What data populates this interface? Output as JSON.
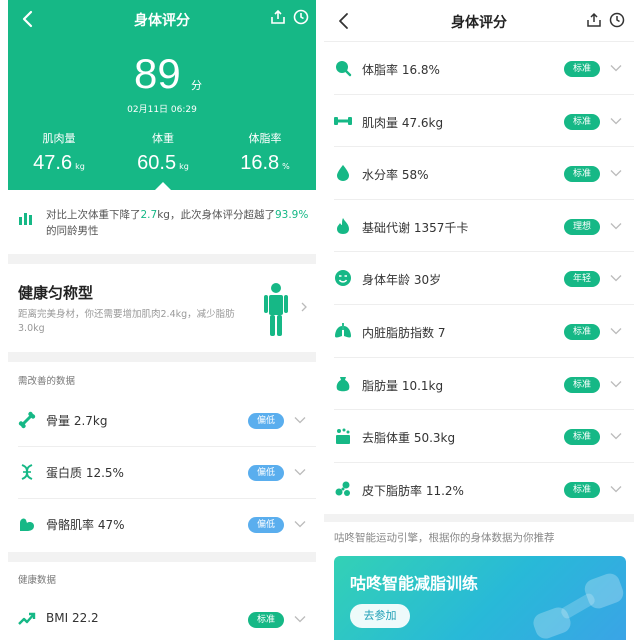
{
  "colors": {
    "accent": "#16b886",
    "low_badge": "#5aaeee",
    "page_sep": "#f2f2f2"
  },
  "left": {
    "header": {
      "title": "身体评分",
      "back_icon": "chevron-left-icon",
      "share_icon": "share-icon",
      "history_icon": "clock-icon"
    },
    "score": {
      "value": "89",
      "unit": "分",
      "date": "02月11日 06:29"
    },
    "metrics": [
      {
        "label": "肌肉量",
        "value": "47.6",
        "unit": "kg"
      },
      {
        "label": "体重",
        "value": "60.5",
        "unit": "kg"
      },
      {
        "label": "体脂率",
        "value": "16.8",
        "unit": "%"
      }
    ],
    "compare": {
      "icon": "bar-chart-icon",
      "text_1": "对比上次体重下降了",
      "weight_change": "2.7",
      "text_2": "kg，此次身体评分超越了",
      "percent": "93.9%",
      "text_3": "的同龄男性"
    },
    "body_type": {
      "title": "健康匀称型",
      "description": "距离完美身材，你还需要增加肌肉2.4kg，减少脂肪3.0kg",
      "figure_icon": "person-icon"
    },
    "improve_section": {
      "heading": "需改善的数据",
      "items": [
        {
          "icon": "bone-icon",
          "label": "骨量 2.7kg",
          "badge": "偏低"
        },
        {
          "icon": "dna-icon",
          "label": "蛋白质 12.5%",
          "badge": "偏低"
        },
        {
          "icon": "muscle-arm-icon",
          "label": "骨骼肌率 47%",
          "badge": "偏低"
        }
      ]
    },
    "healthy_section": {
      "heading": "健康数据",
      "items": [
        {
          "icon": "trend-up-icon",
          "label": "BMI 22.2",
          "badge": "标准"
        }
      ]
    }
  },
  "right": {
    "header": {
      "title": "身体评分",
      "back_icon": "chevron-left-icon",
      "share_icon": "share-icon",
      "history_icon": "clock-icon"
    },
    "items": [
      {
        "icon": "fat-drop-icon",
        "label": "体脂率 16.8%",
        "badge": "标准"
      },
      {
        "icon": "dumbbell-icon",
        "label": "肌肉量 47.6kg",
        "badge": "标准"
      },
      {
        "icon": "water-drop-icon",
        "label": "水分率 58%",
        "badge": "标准"
      },
      {
        "icon": "flame-icon",
        "label": "基础代谢 1357千卡",
        "badge": "理想"
      },
      {
        "icon": "smiley-icon",
        "label": "身体年龄 30岁",
        "badge": "年轻"
      },
      {
        "icon": "lungs-icon",
        "label": "内脏脂肪指数 7",
        "badge": "标准"
      },
      {
        "icon": "weight-bag-icon",
        "label": "脂肪量 10.1kg",
        "badge": "标准"
      },
      {
        "icon": "lean-body-icon",
        "label": "去脂体重 50.3kg",
        "badge": "标准"
      },
      {
        "icon": "subcutaneous-fat-icon",
        "label": "皮下脂肪率 11.2%",
        "badge": "标准"
      }
    ],
    "recommend_note": "咕咚智能运动引擎，根据你的身体数据为你推荐",
    "promo": {
      "title": "咕咚智能减脂训练",
      "button": "去参加"
    }
  }
}
